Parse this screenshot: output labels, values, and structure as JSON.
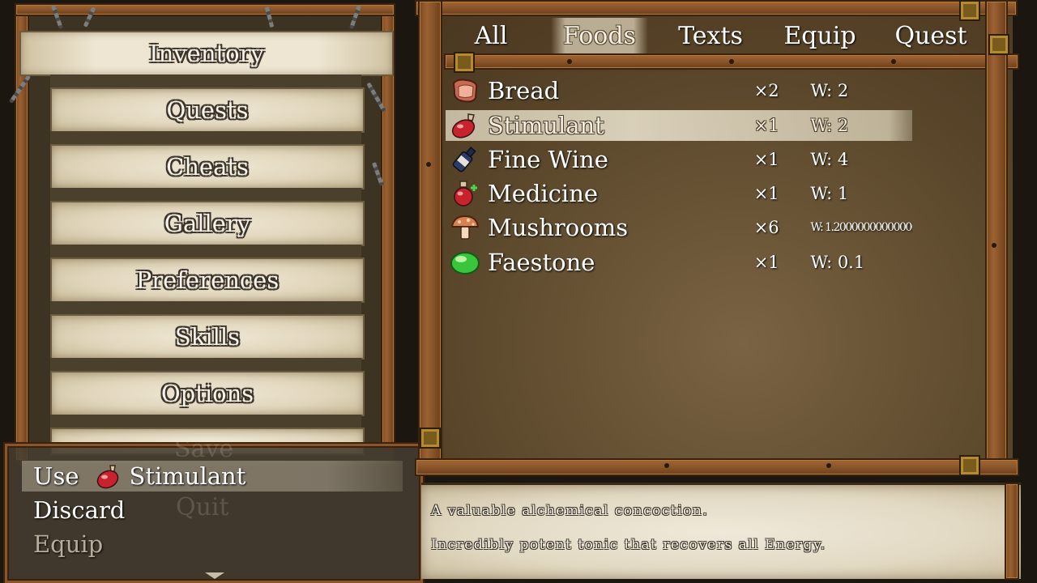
{
  "menu": {
    "items": [
      {
        "label": "Inventory",
        "active": true
      },
      {
        "label": "Quests"
      },
      {
        "label": "Cheats"
      },
      {
        "label": "Gallery"
      },
      {
        "label": "Preferences"
      },
      {
        "label": "Skills"
      },
      {
        "label": "Options"
      }
    ],
    "obscured_items": [
      "Save",
      "Quit"
    ]
  },
  "action_popup": {
    "use_label": "Use",
    "use_item": "Stimulant",
    "discard_label": "Discard",
    "equip_label": "Equip"
  },
  "inventory": {
    "tabs": [
      {
        "label": "All"
      },
      {
        "label": "Foods",
        "active": true
      },
      {
        "label": "Texts"
      },
      {
        "label": "Equip"
      },
      {
        "label": "Quest"
      }
    ],
    "items": [
      {
        "name": "Bread",
        "qty": "×2",
        "weight": "W: 2",
        "icon": "bread-icon"
      },
      {
        "name": "Stimulant",
        "qty": "×1",
        "weight": "W: 2",
        "icon": "red-potion-icon",
        "selected": true
      },
      {
        "name": "Fine Wine",
        "qty": "×1",
        "weight": "W: 4",
        "icon": "wine-bottle-icon"
      },
      {
        "name": "Medicine",
        "qty": "×1",
        "weight": "W: 1",
        "icon": "medicine-flask-icon"
      },
      {
        "name": "Mushrooms",
        "qty": "×6",
        "weight": "W: 1.2000000000000002",
        "icon": "mushroom-icon"
      },
      {
        "name": "Faestone",
        "qty": "×1",
        "weight": "W: 0.1",
        "icon": "green-orb-icon"
      }
    ]
  },
  "description": {
    "line1": "A valuable alchemical concoction.",
    "line2": "Incredibly potent tonic that recovers all Energy."
  },
  "colors": {
    "wood": "#8a552a",
    "parchment": "#e8dfc9",
    "panel_brown": "#5e4a2d"
  }
}
